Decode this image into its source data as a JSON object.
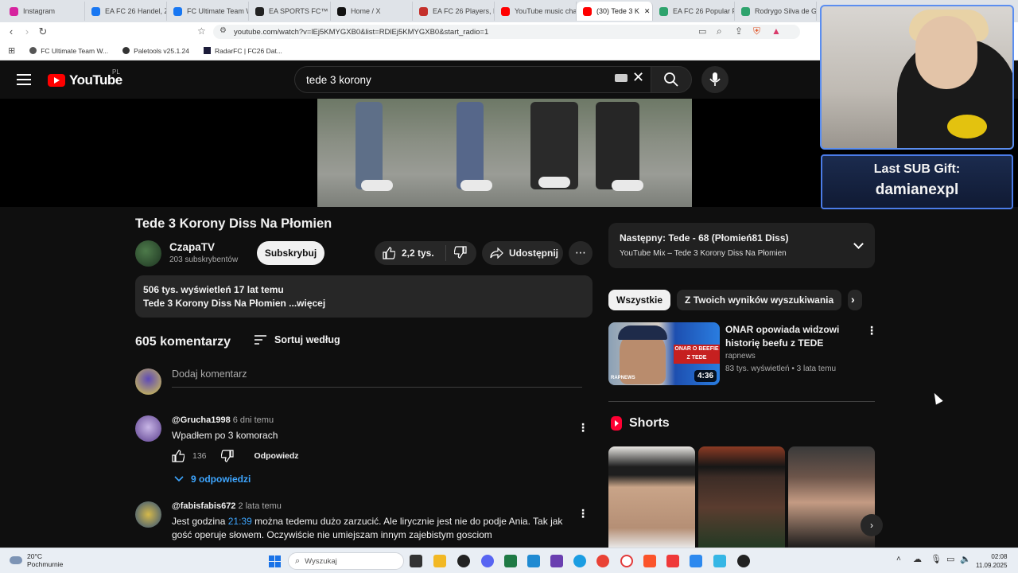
{
  "browser": {
    "tabs": [
      {
        "label": "Instagram",
        "color": "#d6249f"
      },
      {
        "label": "EA FC 26 Handel, Z",
        "color": "#1877f2"
      },
      {
        "label": "FC Ultimate Team W",
        "color": "#1877f2"
      },
      {
        "label": "EA SPORTS FC™ 26",
        "color": "#222222"
      },
      {
        "label": "Home / X",
        "color": "#111111"
      },
      {
        "label": "EA FC 26 Players, P",
        "color": "#c4302b"
      },
      {
        "label": "YouTube music cha",
        "color": "#ff0000"
      },
      {
        "label": "(30) Tede 3 K",
        "color": "#ff0000"
      },
      {
        "label": "EA FC 26 Popular P",
        "color": "#2ea36d"
      },
      {
        "label": "Rodrygo Silva de G",
        "color": "#2ea36d"
      }
    ],
    "active_tab_close": "✕",
    "url": "youtube.com/watch?v=lEj5KMYGXB0&list=RDlEj5KMYGXB0&start_radio=1",
    "bookmarks": [
      {
        "label": "FC Ultimate Team W..."
      },
      {
        "label": "Paletools v25.1.24"
      },
      {
        "label": "RadarFC | FC26 Dat..."
      }
    ]
  },
  "youtube": {
    "logo_text": "YouTube",
    "country_code": "PL",
    "search_value": "tede 3 korony",
    "video": {
      "title": "Tede 3 Korony Diss Na Płomien",
      "channel": "CzapaTV",
      "subscribers": "203 subskrybentów",
      "subscribe_label": "Subskrybuj",
      "likes": "2,2 tys.",
      "share_label": "Udostępnij",
      "description_meta": "506 tys. wyświetleń  17 lat temu",
      "description_text": "Tede 3 Korony Diss Na Płomien ...więcej"
    },
    "comments": {
      "count_label": "605 komentarzy",
      "sort_label": "Sortuj według",
      "add_placeholder": "Dodaj komentarz",
      "items": [
        {
          "author": "@Grucha1998",
          "time": "6 dni temu",
          "text": "Wpadłem po 3 komorach",
          "likes": "136",
          "reply_label": "Odpowiedz",
          "replies_label": "9 odpowiedzi"
        },
        {
          "author": "@fabisfabis672",
          "time": "2 lata temu",
          "text_before": "Jest godzina ",
          "timestamp_link": "21:39",
          "text_after": " można tedemu dużo zarzucić. Ale lirycznie jest nie do podje Ania. Tak jak gość operuje słowem. Oczywiście nie umiejszam innym zajebistym gosciom"
        }
      ]
    },
    "sidebar": {
      "next_title": "Następny: Tede - 68 (Płomień81 Diss)",
      "next_subtitle": "YouTube Mix – Tede 3 Korony Diss Na Płomien",
      "chips": [
        "Wszystkie",
        "Z Twoich wyników wyszukiwania"
      ],
      "recommended": {
        "title": "ONAR opowiada widzowi historię beefu z TEDE",
        "channel": "rapnews",
        "meta": "83 tys. wyświetleń • 3 lata temu",
        "duration": "4:36",
        "thumb_text": "ONAR O BEEFIE Z TEDE",
        "thumb_brand": "RAPNEWS"
      },
      "shorts_label": "Shorts"
    }
  },
  "overlay": {
    "sub_gift_line1": "Last SUB Gift:",
    "sub_gift_line2": "damianexpl"
  },
  "taskbar": {
    "weather_temp": "20°C",
    "weather_desc": "Pochmurnie",
    "search_placeholder": "Wyszukaj",
    "time": "02:08",
    "date": "11.09.2025"
  }
}
